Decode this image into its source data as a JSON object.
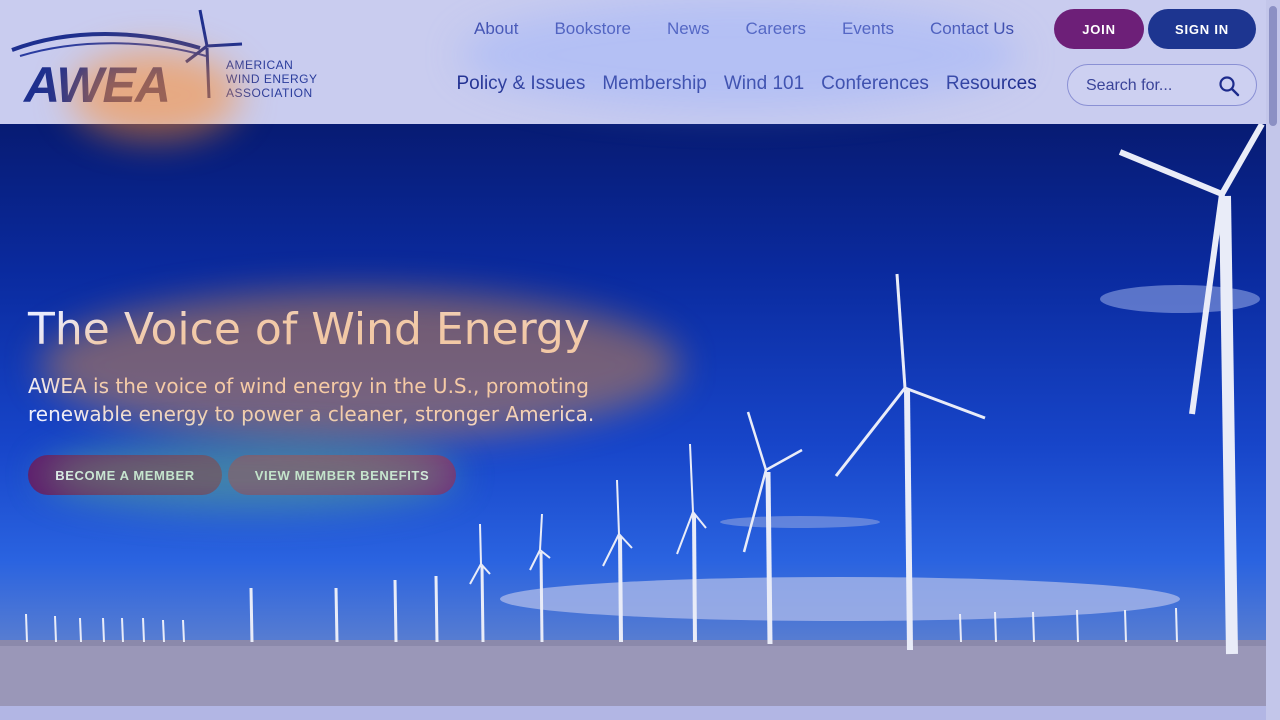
{
  "logo": {
    "word": "AWEA",
    "line1": "AMERICAN",
    "line2": "WIND ENERGY",
    "line3": "ASSOCIATION"
  },
  "util_nav": [
    "About",
    "Bookstore",
    "News",
    "Careers",
    "Events",
    "Contact Us"
  ],
  "buttons": {
    "join": "JOIN",
    "sign_in": "SIGN IN"
  },
  "main_nav": [
    "Policy & Issues",
    "Membership",
    "Wind 101",
    "Conferences",
    "Resources"
  ],
  "search": {
    "placeholder": "Search for..."
  },
  "hero": {
    "title": "The Voice of Wind Energy",
    "subtitle": "AWEA is the voice of wind energy in the U.S., promoting renewable energy to power a cleaner, stronger America.",
    "cta_primary": "BECOME A MEMBER",
    "cta_secondary": "VIEW MEMBER BENEFITS"
  },
  "colors": {
    "brand_navy": "#1d2f8f",
    "join_purple": "#6d1f78",
    "signin_blue": "#1d3590"
  }
}
